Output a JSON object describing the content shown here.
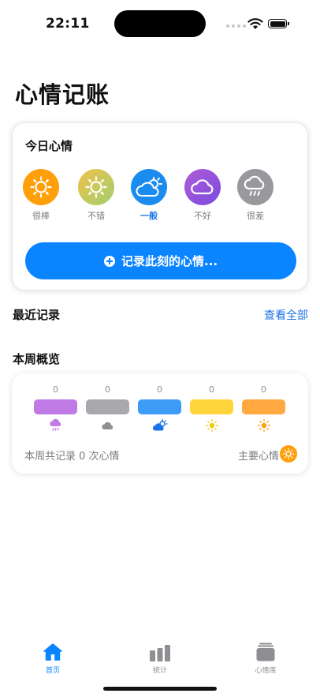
{
  "status": {
    "time": "22:11"
  },
  "page": {
    "title": "心情记账"
  },
  "today": {
    "title": "今日心情",
    "moods": [
      {
        "label": "很棒",
        "icon": "sun-icon",
        "color": "#ff9f0a"
      },
      {
        "label": "不错",
        "icon": "sun-icon",
        "color": "#e3c44a"
      },
      {
        "label": "一般",
        "icon": "partly-cloudy-icon",
        "color": "#1a8cf0",
        "selected": true
      },
      {
        "label": "不好",
        "icon": "cloud-icon",
        "color": "#8e52e0"
      },
      {
        "label": "很差",
        "icon": "rain-icon",
        "color": "#98989d"
      }
    ],
    "record_button": "记录此刻的心情..."
  },
  "recent": {
    "title": "最近记录",
    "view_all": "查看全部"
  },
  "week": {
    "title": "本周概览",
    "bars": [
      {
        "count": "0",
        "color": "#bf7ae6",
        "icon": "rain-icon"
      },
      {
        "count": "0",
        "color": "#a8a8ad",
        "icon": "cloud-icon"
      },
      {
        "count": "0",
        "color": "#3d9cf5",
        "icon": "partly-cloudy-icon"
      },
      {
        "count": "0",
        "color": "#ffd43b",
        "icon": "sun-icon"
      },
      {
        "count": "0",
        "color": "#ffa940",
        "icon": "sun-icon"
      }
    ],
    "summary": "本周共记录 0 次心情",
    "main_mood_label": "主要心情"
  },
  "tabs": [
    {
      "label": "首页",
      "icon": "home-icon",
      "active": true
    },
    {
      "label": "统计",
      "icon": "chart-icon",
      "active": false
    },
    {
      "label": "心情库",
      "icon": "library-icon",
      "active": false
    }
  ]
}
